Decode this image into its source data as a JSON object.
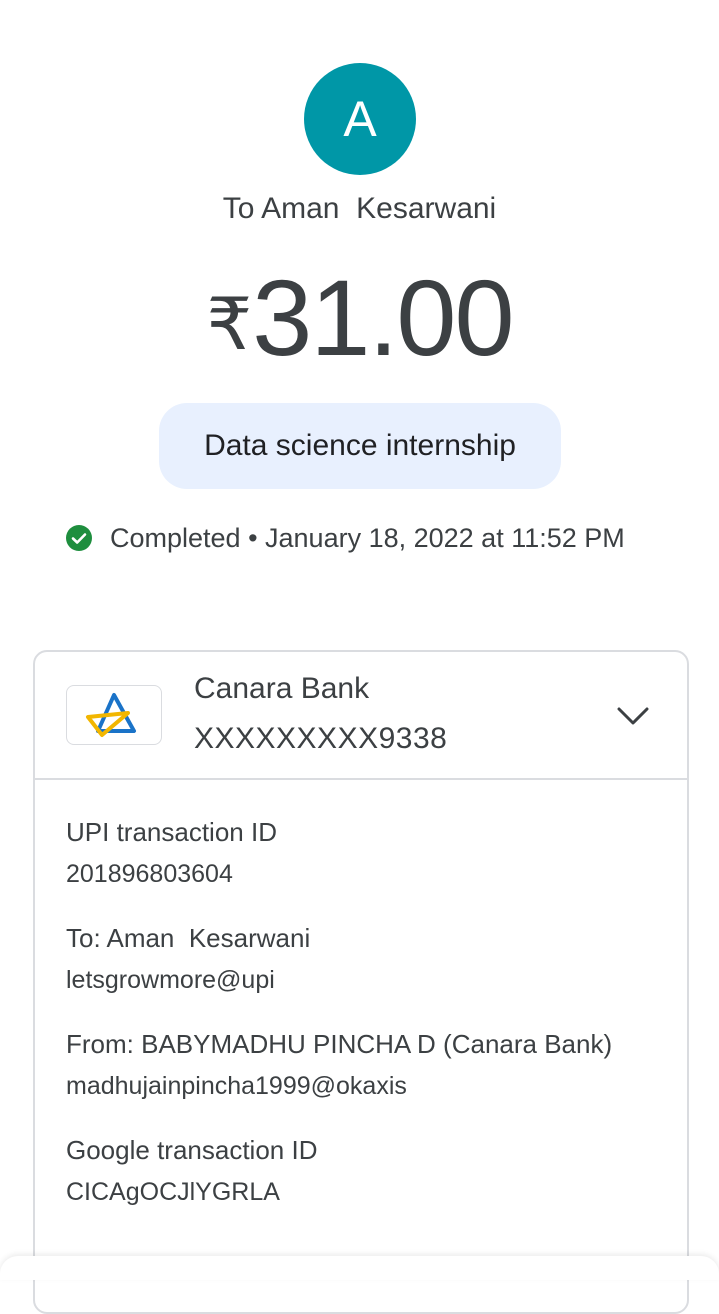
{
  "payee": {
    "avatar_initial": "A",
    "title": "To Aman  Kesarwani"
  },
  "amount": {
    "currency_symbol": "₹",
    "value": "31.00"
  },
  "note": "Data science internship",
  "status": {
    "icon": "check-circle-icon",
    "text": "Completed • January 18, 2022 at 11:52 PM"
  },
  "bank": {
    "name": "Canara Bank",
    "account": "XXXXXXXXX9338",
    "logo": "canara-bank-logo",
    "expand_icon": "chevron-down-icon"
  },
  "details": [
    {
      "label": "UPI transaction ID",
      "value": "201896803604"
    },
    {
      "label": "To: Aman  Kesarwani",
      "value": "letsgrowmore@upi"
    },
    {
      "label": "From: BABYMADHU PINCHA D (Canara Bank)",
      "value": "madhujainpincha1999@okaxis"
    },
    {
      "label": "Google transaction ID",
      "value": "CICAgOCJlYGRLA"
    }
  ],
  "colors": {
    "avatar_bg": "#0097a7",
    "note_chip_bg": "#e8f0fe",
    "success_green": "#1e8e3e",
    "text_primary": "#3c4043",
    "border": "#dadce0"
  }
}
